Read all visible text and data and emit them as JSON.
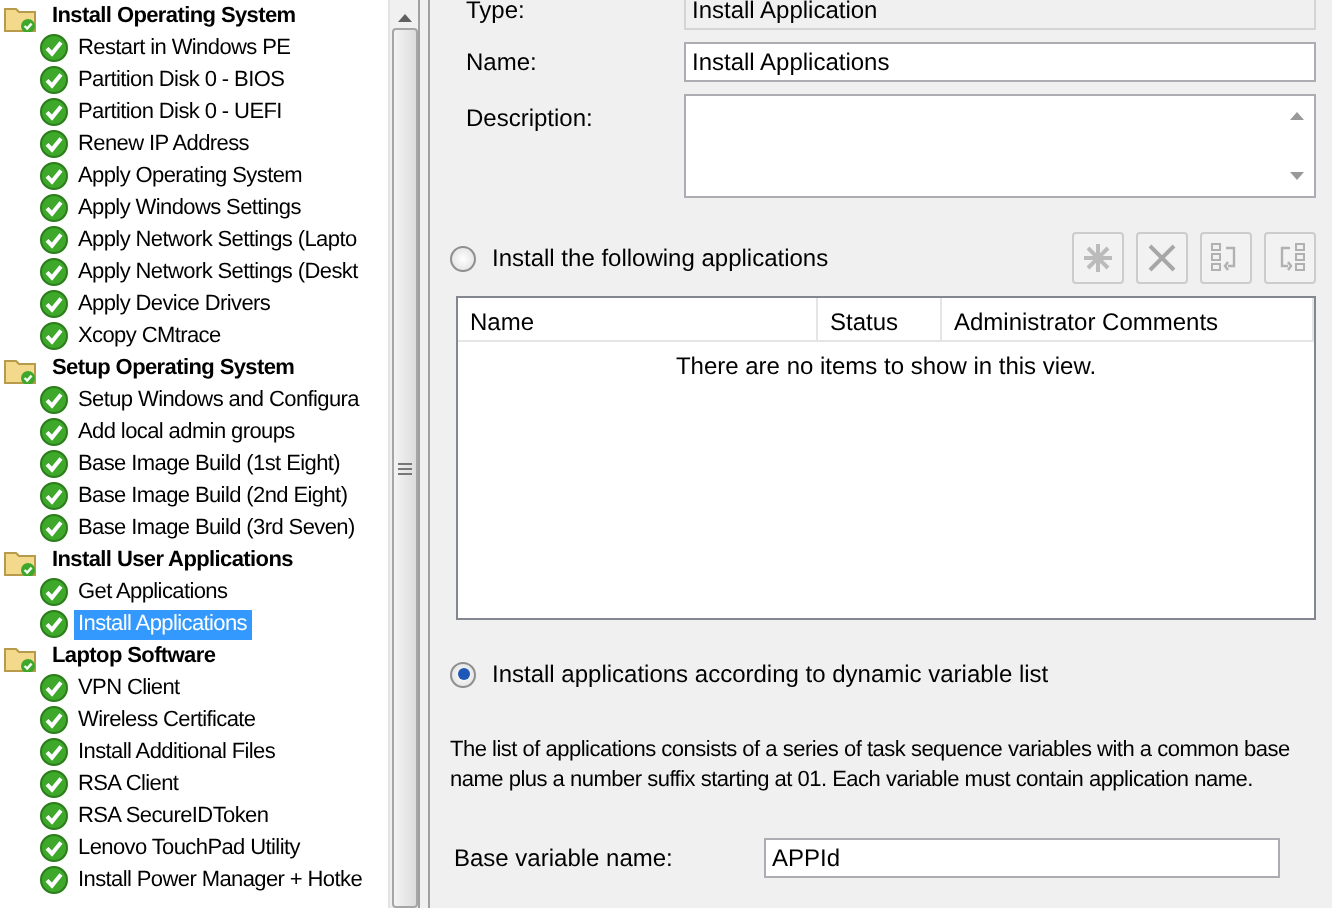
{
  "tree": [
    {
      "label": "Install Operating System",
      "selected": false,
      "children": [
        {
          "label": "Restart in Windows PE",
          "selected": false
        },
        {
          "label": "Partition Disk 0 - BIOS",
          "selected": false
        },
        {
          "label": "Partition Disk 0 - UEFI",
          "selected": false
        },
        {
          "label": "Renew IP Address",
          "selected": false
        },
        {
          "label": "Apply Operating System",
          "selected": false
        },
        {
          "label": "Apply Windows Settings",
          "selected": false
        },
        {
          "label": "Apply Network Settings (Lapto",
          "selected": false
        },
        {
          "label": "Apply Network Settings (Deskt",
          "selected": false
        },
        {
          "label": "Apply Device Drivers",
          "selected": false
        },
        {
          "label": "Xcopy CMtrace",
          "selected": false
        }
      ]
    },
    {
      "label": "Setup Operating System",
      "selected": false,
      "children": [
        {
          "label": "Setup Windows and Configura",
          "selected": false
        },
        {
          "label": "Add local admin groups",
          "selected": false
        },
        {
          "label": "Base Image Build (1st Eight)",
          "selected": false
        },
        {
          "label": "Base Image Build (2nd Eight)",
          "selected": false
        },
        {
          "label": "Base Image Build (3rd Seven)",
          "selected": false
        }
      ]
    },
    {
      "label": "Install User Applications",
      "selected": false,
      "children": [
        {
          "label": "Get Applications",
          "selected": false
        },
        {
          "label": "Install Applications",
          "selected": true
        }
      ]
    },
    {
      "label": "Laptop Software",
      "selected": false,
      "children": [
        {
          "label": "VPN Client",
          "selected": false
        },
        {
          "label": "Wireless Certificate",
          "selected": false
        },
        {
          "label": "Install Additional Files",
          "selected": false
        },
        {
          "label": "RSA Client",
          "selected": false
        },
        {
          "label": "RSA SecureIDToken",
          "selected": false
        },
        {
          "label": "Lenovo TouchPad Utility",
          "selected": false
        },
        {
          "label": "Install Power Manager + Hotke",
          "selected": false
        }
      ]
    }
  ],
  "type_field": {
    "label": "Type:",
    "value": "Install Application"
  },
  "name_field": {
    "label": "Name:",
    "value": "Install Applications"
  },
  "description_field": {
    "label": "Description:"
  },
  "install_options": [
    {
      "label": "Install the following applications",
      "selected": false
    },
    {
      "label": "Install applications according to dynamic variable list",
      "selected": true
    }
  ],
  "toolbar_buttons": [
    {
      "kind": "add",
      "disabled": true
    },
    {
      "kind": "delete",
      "disabled": true
    },
    {
      "kind": "up",
      "disabled": true
    },
    {
      "kind": "down",
      "disabled": true
    }
  ],
  "applications_table": {
    "columns": [
      "Name",
      "Status",
      "Administrator Comments"
    ],
    "empty_message": "There are no items to show in this view."
  },
  "info_text": "The list of applications consists of a series of task sequence variables with a common base name plus a number suffix starting at 01.  Each variable must contain application name.",
  "base_variable_field": {
    "label": "Base variable name:",
    "value": "APPId"
  }
}
